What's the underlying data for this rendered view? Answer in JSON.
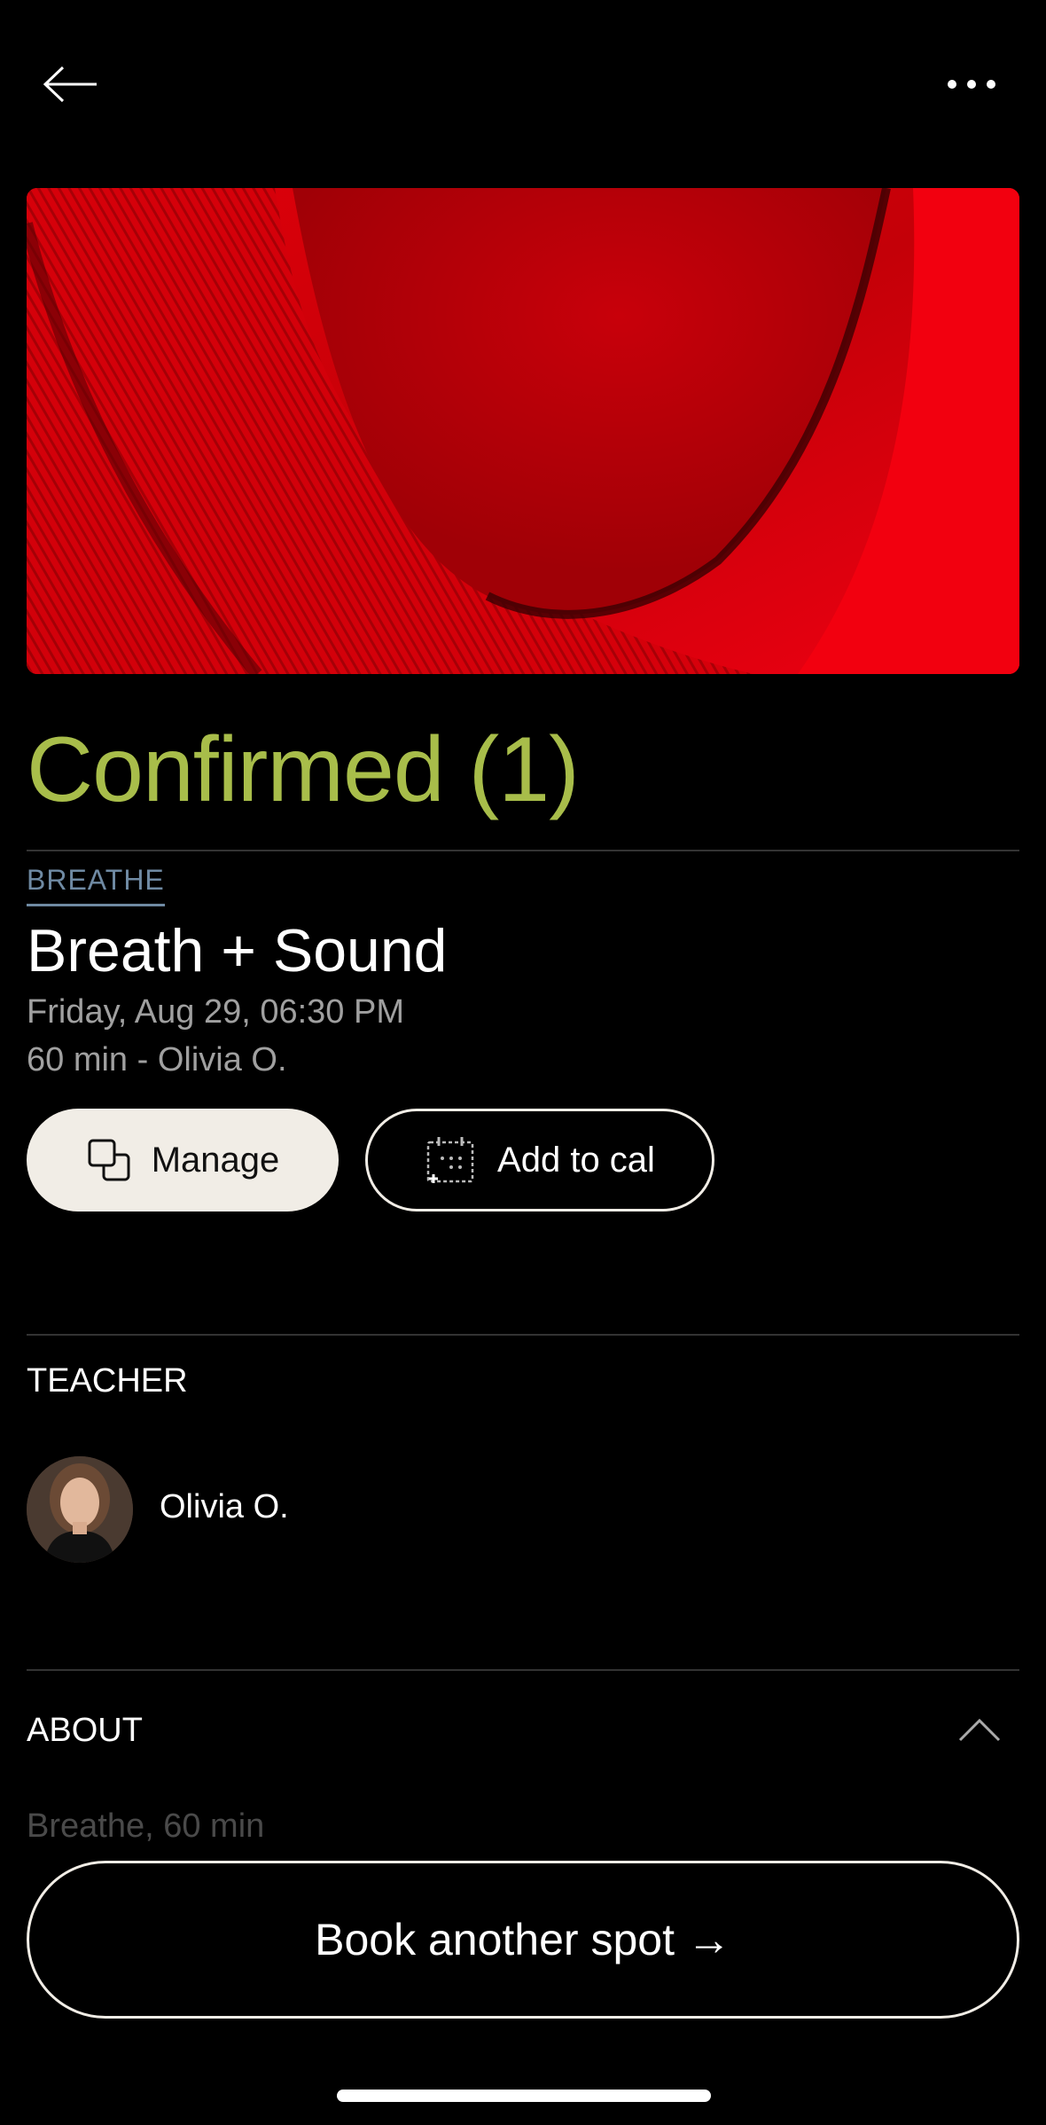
{
  "header": {
    "back_icon": "arrow-left-icon",
    "more_icon": "more-horizontal-icon"
  },
  "hero": {
    "image": "red-ribbed-fabric-photo"
  },
  "booking": {
    "status": "Confirmed (1)",
    "status_color": "#a8bd4a",
    "category": "BREATHE",
    "category_color": "#6f8aa3",
    "class_name": "Breath + Sound",
    "datetime": "Friday, Aug 29, 06:30 PM",
    "duration_teacher": "60 min - Olivia O."
  },
  "actions": {
    "manage_label": "Manage",
    "manage_icon": "manage-icon",
    "add_to_cal_label": "Add to cal",
    "add_to_cal_icon": "calendar-add-icon"
  },
  "teacher": {
    "section_title": "TEACHER",
    "name": "Olivia O."
  },
  "about": {
    "section_title": "ABOUT",
    "text": "Breathe, 60 min",
    "toggle_icon": "chevron-up-icon"
  },
  "footer": {
    "book_label": "Book another spot →"
  }
}
